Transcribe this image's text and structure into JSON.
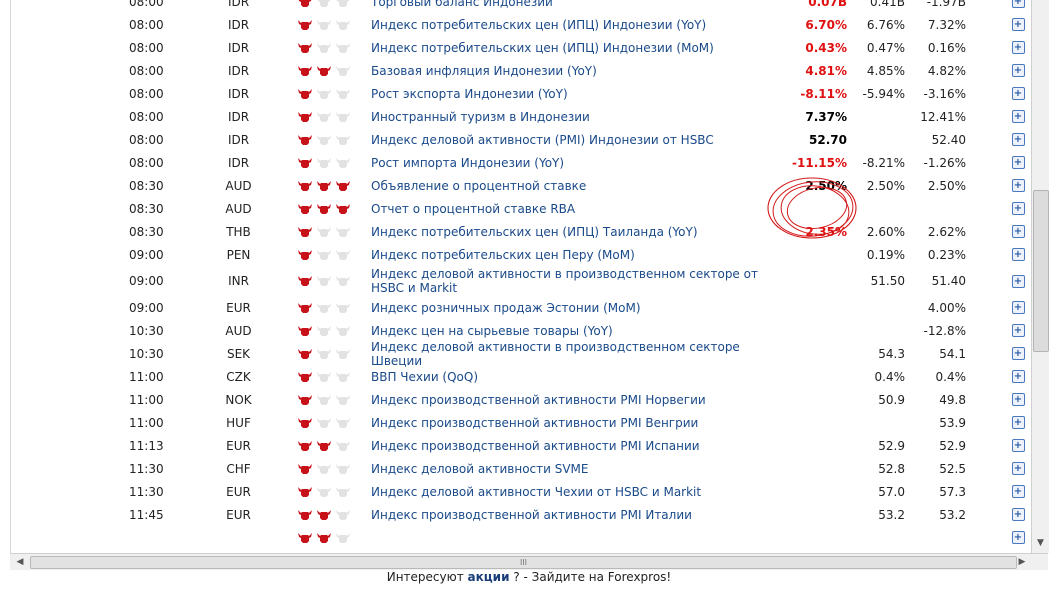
{
  "rows": [
    {
      "time": "08:00",
      "currency": "IDR",
      "importance": 1,
      "event": "Торговый баланс Индонезии",
      "actual": "0.07B",
      "actual_color": "red",
      "forecast": "0.41B",
      "previous": "-1.97B"
    },
    {
      "time": "08:00",
      "currency": "IDR",
      "importance": 1,
      "event": "Индекс потребительских цен (ИПЦ) Индонезии (YoY)",
      "actual": "6.70%",
      "actual_color": "red",
      "forecast": "6.76%",
      "previous": "7.32%"
    },
    {
      "time": "08:00",
      "currency": "IDR",
      "importance": 1,
      "event": "Индекс потребительских цен (ИПЦ) Индонезии (MoM)",
      "actual": "0.43%",
      "actual_color": "red",
      "forecast": "0.47%",
      "previous": "0.16%"
    },
    {
      "time": "08:00",
      "currency": "IDR",
      "importance": 2,
      "event": "Базовая инфляция Индонезии (YoY)",
      "actual": "4.81%",
      "actual_color": "red",
      "forecast": "4.85%",
      "previous": "4.82%"
    },
    {
      "time": "08:00",
      "currency": "IDR",
      "importance": 1,
      "event": "Рост экспорта Индонезии (YoY)",
      "actual": "-8.11%",
      "actual_color": "red",
      "forecast": "-5.94%",
      "previous": "-3.16%"
    },
    {
      "time": "08:00",
      "currency": "IDR",
      "importance": 1,
      "event": "Иностранный туризм в Индонезии",
      "actual": "7.37%",
      "actual_color": "black",
      "forecast": "",
      "previous": "12.41%"
    },
    {
      "time": "08:00",
      "currency": "IDR",
      "importance": 1,
      "event": "Индекс деловой активности (PMI) Индонезии от HSBC",
      "actual": "52.70",
      "actual_color": "black",
      "forecast": "",
      "previous": "52.40"
    },
    {
      "time": "08:00",
      "currency": "IDR",
      "importance": 1,
      "event": "Рост импорта Индонезии (YoY)",
      "actual": "-11.15%",
      "actual_color": "red",
      "forecast": "-8.21%",
      "previous": "-1.26%"
    },
    {
      "time": "08:30",
      "currency": "AUD",
      "importance": 3,
      "event": "Объявление о процентной ставке",
      "actual": "2.50%",
      "actual_color": "black",
      "forecast": "2.50%",
      "previous": "2.50%"
    },
    {
      "time": "08:30",
      "currency": "AUD",
      "importance": 3,
      "event": "Отчет о процентной ставке RBA",
      "actual": "",
      "actual_color": "black",
      "forecast": "",
      "previous": ""
    },
    {
      "time": "08:30",
      "currency": "THB",
      "importance": 1,
      "event": "Индекс потребительских цен (ИПЦ) Таиланда (YoY)",
      "actual": "2.35%",
      "actual_color": "red",
      "forecast": "2.60%",
      "previous": "2.62%"
    },
    {
      "time": "09:00",
      "currency": "PEN",
      "importance": 1,
      "event": "Индекс потребительских цен Перу (MoM)",
      "actual": "",
      "actual_color": "black",
      "forecast": "0.19%",
      "previous": "0.23%"
    },
    {
      "time": "09:00",
      "currency": "INR",
      "importance": 1,
      "event": "Индекс деловой активности в производственном секторе от HSBC и Markit",
      "actual": "",
      "actual_color": "black",
      "forecast": "51.50",
      "previous": "51.40",
      "tall": true
    },
    {
      "time": "09:00",
      "currency": "EUR",
      "importance": 1,
      "event": "Индекс розничных продаж Эстонии (MoM)",
      "actual": "",
      "actual_color": "black",
      "forecast": "",
      "previous": "4.00%"
    },
    {
      "time": "10:30",
      "currency": "AUD",
      "importance": 1,
      "event": "Индекс цен на сырьевые товары (YoY)",
      "actual": "",
      "actual_color": "black",
      "forecast": "",
      "previous": "-12.8%"
    },
    {
      "time": "10:30",
      "currency": "SEK",
      "importance": 1,
      "event": "Индекс деловой активности в производственном секторе Швеции",
      "actual": "",
      "actual_color": "black",
      "forecast": "54.3",
      "previous": "54.1"
    },
    {
      "time": "11:00",
      "currency": "CZK",
      "importance": 1,
      "event": "ВВП Чехии (QoQ)",
      "actual": "",
      "actual_color": "black",
      "forecast": "0.4%",
      "previous": "0.4%"
    },
    {
      "time": "11:00",
      "currency": "NOK",
      "importance": 1,
      "event": "Индекс производственной активности PMI Норвегии",
      "actual": "",
      "actual_color": "black",
      "forecast": "50.9",
      "previous": "49.8"
    },
    {
      "time": "11:00",
      "currency": "HUF",
      "importance": 1,
      "event": "Индекс производственной активности PMI Венгрии",
      "actual": "",
      "actual_color": "black",
      "forecast": "",
      "previous": "53.9"
    },
    {
      "time": "11:13",
      "currency": "EUR",
      "importance": 2,
      "event": "Индекс производственной активности PMI Испании",
      "actual": "",
      "actual_color": "black",
      "forecast": "52.9",
      "previous": "52.9"
    },
    {
      "time": "11:30",
      "currency": "CHF",
      "importance": 1,
      "event": "Индекс деловой активности SVME",
      "actual": "",
      "actual_color": "black",
      "forecast": "52.8",
      "previous": "52.5"
    },
    {
      "time": "11:30",
      "currency": "EUR",
      "importance": 1,
      "event": "Индекс деловой активности Чехии от HSBC и Markit",
      "actual": "",
      "actual_color": "black",
      "forecast": "57.0",
      "previous": "57.3"
    },
    {
      "time": "11:45",
      "currency": "EUR",
      "importance": 2,
      "event": "Индекс производственной активности PMI Италии",
      "actual": "",
      "actual_color": "black",
      "forecast": "53.2",
      "previous": "53.2"
    },
    {
      "time": "",
      "currency": "",
      "importance": 2,
      "event": "",
      "actual": "",
      "actual_color": "black",
      "forecast": "",
      "previous": ""
    }
  ],
  "icons": {
    "importance": "bull-icon",
    "expand": "plus-icon"
  },
  "colors": {
    "link": "#1a4a8a",
    "actual_red": "#e01010",
    "bull_on": "#c8121a",
    "bull_off": "#e2e2e2"
  },
  "footer": {
    "before": "Интересуют ",
    "link": "акции",
    "after": " ? - Зайдите на Forexpros!"
  },
  "scrollbar": {
    "grip": "III"
  }
}
